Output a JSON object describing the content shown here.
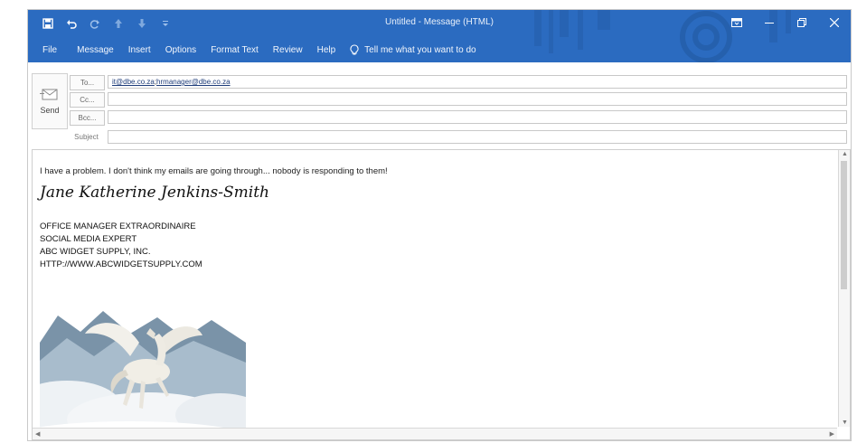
{
  "titlebar": {
    "title": "Untitled  -  Message (HTML)",
    "background": "#2b6bc0",
    "quick_access": [
      "save-icon",
      "undo-icon",
      "redo-icon",
      "up-arrow-icon",
      "down-arrow-icon",
      "customize-icon"
    ]
  },
  "menu": {
    "items": [
      "File",
      "Message",
      "Insert",
      "Options",
      "Format Text",
      "Review",
      "Help"
    ],
    "tell_me": "Tell me what you want to do"
  },
  "compose": {
    "send_label": "Send",
    "to_label": "To...",
    "cc_label": "Cc...",
    "bcc_label": "Bcc...",
    "subject_label": "Subject",
    "to_value_1": "it@dbe.co.za",
    "to_sep": "; ",
    "to_value_2": "hrmanager@dbe.co.za",
    "cc_value": "",
    "bcc_value": "",
    "subject_value": ""
  },
  "body": {
    "message": "I have a problem. I don't think my emails are going through... nobody is responding to them!",
    "signature_name": "Jane Katherine Jenkins-Smith",
    "signature_lines": [
      "OFFICE MANAGER EXTRAORDINAIRE",
      "SOCIAL MEDIA EXPERT",
      "ABC WIDGET SUPPLY, INC.",
      "HTTP://WWW.ABCWIDGETSUPPLY.COM"
    ]
  }
}
